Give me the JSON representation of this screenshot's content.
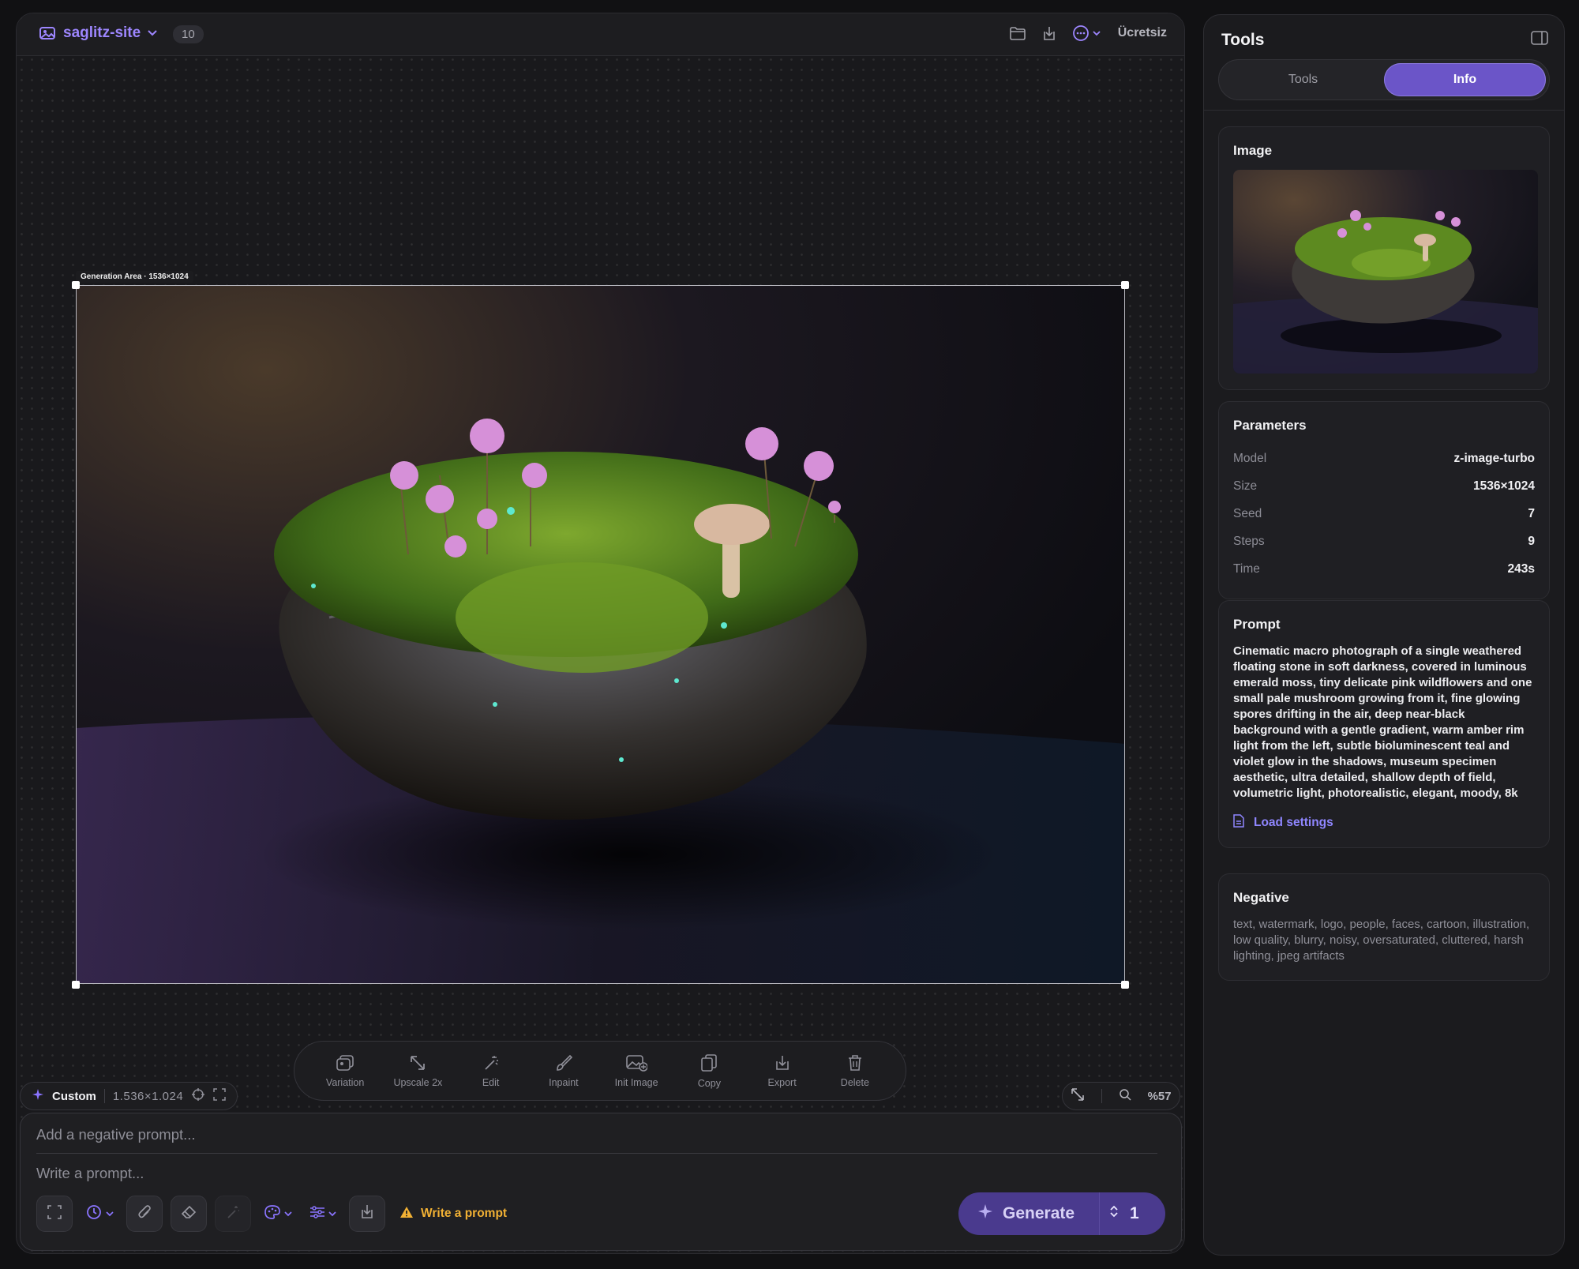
{
  "header": {
    "project_name": "saglitz-site",
    "count": "10",
    "plan": "Ücretsiz"
  },
  "canvas": {
    "generation_label": "Generation Area · 1536×1024"
  },
  "actions": [
    {
      "label": "Variation",
      "icon": "variation-icon"
    },
    {
      "label": "Upscale 2x",
      "icon": "upscale-icon"
    },
    {
      "label": "Edit",
      "icon": "edit-wand-icon"
    },
    {
      "label": "Inpaint",
      "icon": "brush-icon"
    },
    {
      "label": "Init Image",
      "icon": "image-add-icon"
    },
    {
      "label": "Copy",
      "icon": "copy-icon"
    },
    {
      "label": "Export",
      "icon": "export-icon"
    },
    {
      "label": "Delete",
      "icon": "trash-icon"
    }
  ],
  "size_pill": {
    "label": "Custom",
    "dimensions": "1.536×1.024"
  },
  "zoom": {
    "value": "%57"
  },
  "prompt": {
    "negative_placeholder": "Add a negative prompt...",
    "positive_placeholder": "Write a prompt...",
    "warning": "Write a prompt",
    "generate_label": "Generate",
    "batch_count": "1"
  },
  "sidebar": {
    "title": "Tools",
    "tabs": [
      "Tools",
      "Info"
    ],
    "active_tab": "Info",
    "image_heading": "Image",
    "parameters_heading": "Parameters",
    "parameters": [
      {
        "key": "Model",
        "value": "z-image-turbo"
      },
      {
        "key": "Size",
        "value": "1536×1024"
      },
      {
        "key": "Seed",
        "value": "7"
      },
      {
        "key": "Steps",
        "value": "9"
      },
      {
        "key": "Time",
        "value": "243s"
      }
    ],
    "prompt_heading": "Prompt",
    "prompt_text": "Cinematic macro photograph of a single weathered floating stone in soft darkness, covered in luminous emerald moss, tiny delicate pink wildflowers and one small pale mushroom growing from it, fine glowing spores drifting in the air, deep near-black background with a gentle gradient, warm amber rim light from the left, subtle bioluminescent teal and violet glow in the shadows, museum specimen aesthetic, ultra detailed, shallow depth of field, volumetric light, photorealistic, elegant, moody, 8k",
    "load_settings": "Load settings",
    "negative_heading": "Negative",
    "negative_text": "text, watermark, logo, people, faces, cartoon, illustration, low quality, blurry, noisy, oversaturated, cluttered, harsh lighting, jpeg artifacts"
  },
  "colors": {
    "accent": "#6b55c8",
    "accent_text": "#9d86ff",
    "warning": "#f2b134",
    "generate_bg": "#4a3a8e"
  }
}
